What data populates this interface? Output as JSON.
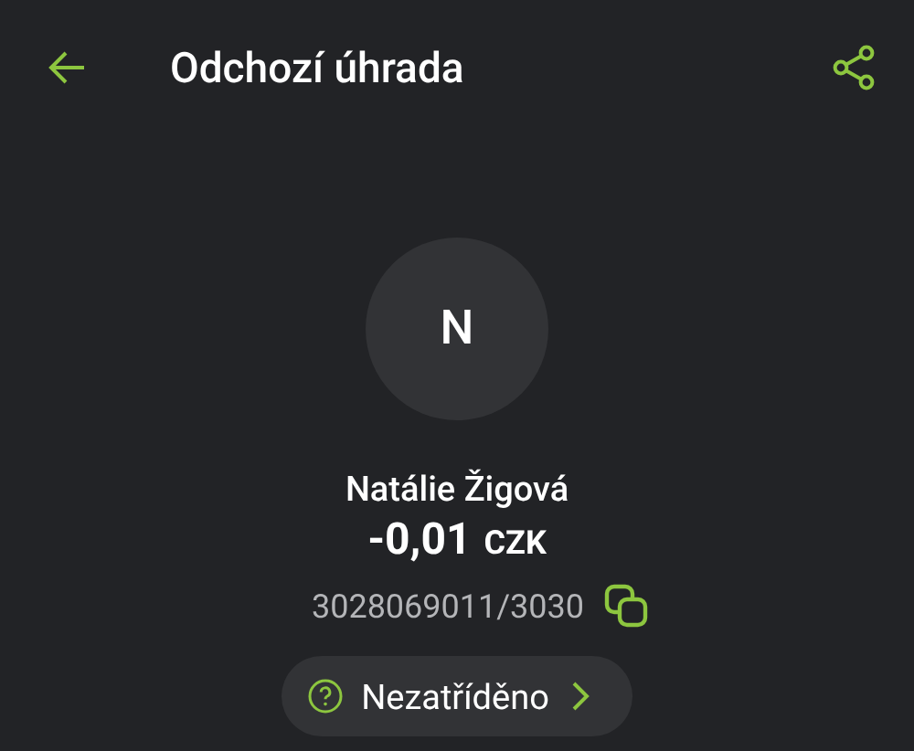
{
  "header": {
    "title": "Odchozí úhrada"
  },
  "avatar": {
    "initial": "N"
  },
  "payment": {
    "name": "Natálie Žigová",
    "amount": "-0,01",
    "currency": "CZK",
    "account": "3028069011/3030"
  },
  "category": {
    "label": "Nezatříděno"
  }
}
